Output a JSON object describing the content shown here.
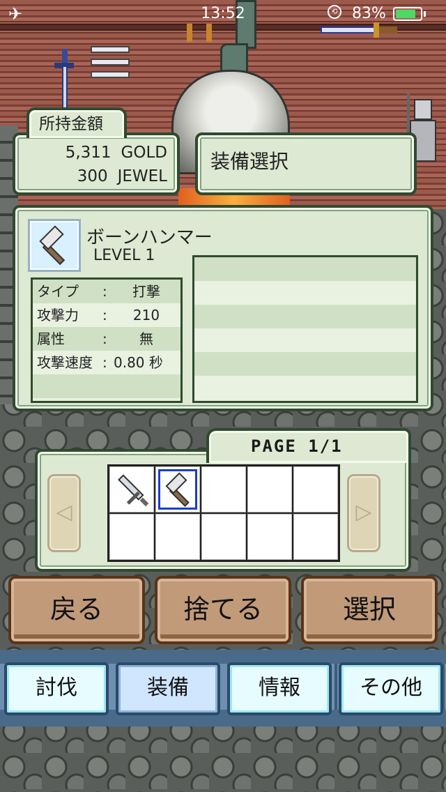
{
  "status_bar": {
    "time": "13:52",
    "battery_percent": "83%",
    "battery_level": 0.83
  },
  "wallet": {
    "tab_label": "所持金額",
    "gold_amount": "5,311",
    "gold_unit": "GOLD",
    "jewel_amount": "300",
    "jewel_unit": "JEWEL"
  },
  "screen": {
    "title": "装備選択"
  },
  "item": {
    "icon": "hammer-icon",
    "name": "ボーンハンマー",
    "level": "LEVEL 1",
    "stats": [
      {
        "label": "タイプ",
        "value": "打撃"
      },
      {
        "label": "攻撃力",
        "value": "210"
      },
      {
        "label": "属性",
        "value": "無"
      },
      {
        "label": "攻撃速度",
        "value": "0.80 秒"
      }
    ]
  },
  "inventory": {
    "page_label": "PAGE 1/1",
    "slots": [
      {
        "icon": "sword-icon",
        "selected": false
      },
      {
        "icon": "hammer-icon",
        "selected": true
      },
      {
        "icon": "",
        "selected": false
      },
      {
        "icon": "",
        "selected": false
      },
      {
        "icon": "",
        "selected": false
      },
      {
        "icon": "",
        "selected": false
      },
      {
        "icon": "",
        "selected": false
      },
      {
        "icon": "",
        "selected": false
      },
      {
        "icon": "",
        "selected": false
      },
      {
        "icon": "",
        "selected": false
      }
    ]
  },
  "actions": {
    "back": "戻る",
    "discard": "捨てる",
    "select": "選択"
  },
  "nav": {
    "items": [
      "討伐",
      "装備",
      "情報",
      "その他"
    ],
    "active_index": 1
  }
}
